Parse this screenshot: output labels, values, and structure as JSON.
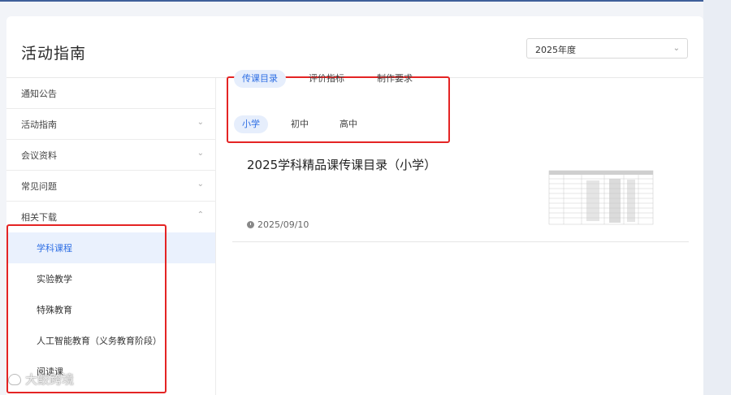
{
  "page": {
    "title": "活动指南"
  },
  "year_select": {
    "value": "2025年度",
    "chevron_icon": "chevron-down-icon"
  },
  "sidebar": {
    "items": [
      {
        "label": "通知公告",
        "chevron": ""
      },
      {
        "label": "活动指南",
        "chevron": "⌄"
      },
      {
        "label": "会议资料",
        "chevron": "⌄"
      },
      {
        "label": "常见问题",
        "chevron": "⌄"
      },
      {
        "label": "相关下载",
        "chevron": "⌃"
      }
    ],
    "subitems": [
      {
        "label": "学科课程",
        "active": true
      },
      {
        "label": "实验教学",
        "active": false
      },
      {
        "label": "特殊教育",
        "active": false
      },
      {
        "label": "人工智能教育（义务教育阶段）",
        "active": false
      },
      {
        "label": "阅读课",
        "active": false
      }
    ]
  },
  "tabs": {
    "category": [
      {
        "label": "传课目录",
        "active": true
      },
      {
        "label": "评价指标",
        "active": false
      },
      {
        "label": "制作要求",
        "active": false
      }
    ],
    "level": [
      {
        "label": "小学",
        "active": true
      },
      {
        "label": "初中",
        "active": false
      },
      {
        "label": "高中",
        "active": false
      }
    ]
  },
  "article": {
    "title": "2025学科精品课传课目录（小学）",
    "date": "2025/09/10",
    "date_icon": "clock-icon",
    "thumbnail_icon": "document-table-thumbnail"
  },
  "watermark": {
    "text": "大鲛跨境"
  },
  "colors": {
    "accent": "#2f6fe4",
    "active_bg": "#eaf1fd",
    "highlight_box": "#e42424"
  }
}
